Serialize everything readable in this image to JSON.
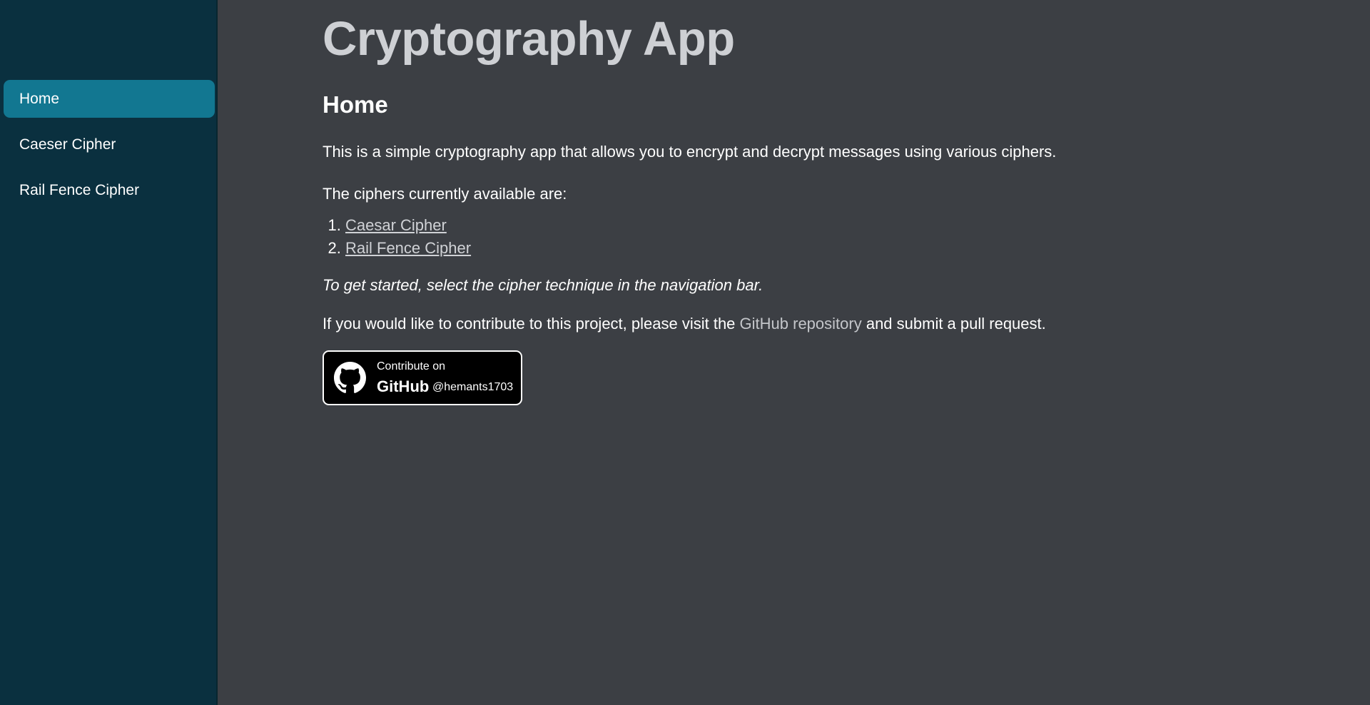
{
  "sidebar": {
    "items": [
      {
        "label": "Home",
        "active": true
      },
      {
        "label": "Caeser Cipher",
        "active": false
      },
      {
        "label": "Rail Fence Cipher",
        "active": false
      }
    ],
    "background": "#0a303f",
    "active_color": "#127791"
  },
  "main": {
    "app_title": "Cryptography App",
    "heading": "Home",
    "intro": "This is a simple cryptography app that allows you to encrypt and decrypt messages using various ciphers.",
    "available_text": "The ciphers currently available are:",
    "ciphers": [
      {
        "num": "1.",
        "label": "Caesar Cipher"
      },
      {
        "num": "2.",
        "label": "Rail Fence Cipher"
      }
    ],
    "start_text": "To get started, select the cipher technique in the navigation bar.",
    "contrib_before": "If you would like to contribute to this project, please visit the ",
    "contrib_link": "GitHub repository",
    "contrib_after": " and submit a pull request.",
    "badge": {
      "icon": "github-icon",
      "small_text": "Contribute on",
      "big_text": "GitHub",
      "handle": "@hemants1703"
    },
    "background": "#3c3f44"
  }
}
